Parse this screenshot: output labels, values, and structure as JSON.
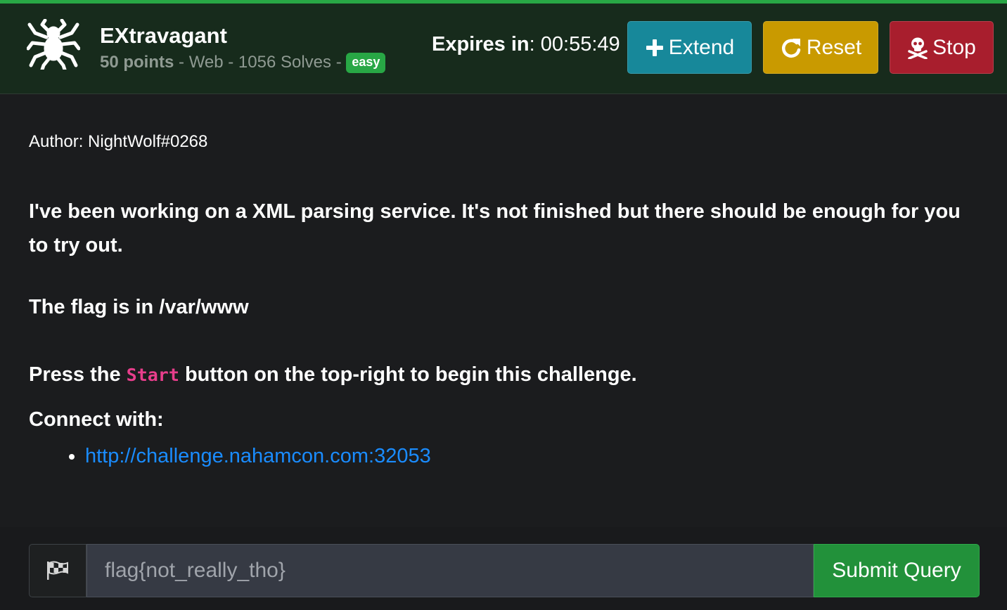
{
  "challenge": {
    "icon": "spider-icon",
    "title": "EXtravagant",
    "points": "50 points",
    "meta_rest": " - Web - 1056 Solves - ",
    "difficulty": "easy"
  },
  "timer": {
    "label": "Expires in",
    "separator": ": ",
    "value": "00:55:49"
  },
  "buttons": {
    "extend": {
      "label": "Extend",
      "icon": "plus-icon",
      "color": "#17889a"
    },
    "reset": {
      "label": "Reset",
      "icon": "redo-icon",
      "color": "#c99a00"
    },
    "stop": {
      "label": "Stop",
      "icon": "skull-crossbones-icon",
      "color": "#a81e2d"
    }
  },
  "description": {
    "author": "Author: NightWolf#0268",
    "paragraph": "I've been working on a XML parsing service. It's not finished but there should be enough for you to try out.",
    "flag_location": "The flag is in /var/www",
    "press_prefix": "Press the ",
    "press_code": "Start",
    "press_suffix": " button on the top-right to begin this challenge.",
    "connect_label": "Connect with:",
    "links": [
      "http://challenge.nahamcon.com:32053"
    ]
  },
  "submission": {
    "flag_icon": "flag-checkered-icon",
    "placeholder": "flag{not_really_tho}",
    "submit_label": "Submit Query"
  },
  "colors": {
    "accent_green": "#28a745",
    "header_bg": "#172b1c",
    "page_bg": "#1b1c1e",
    "link": "#1a8cff",
    "code": "#e83e8c"
  }
}
